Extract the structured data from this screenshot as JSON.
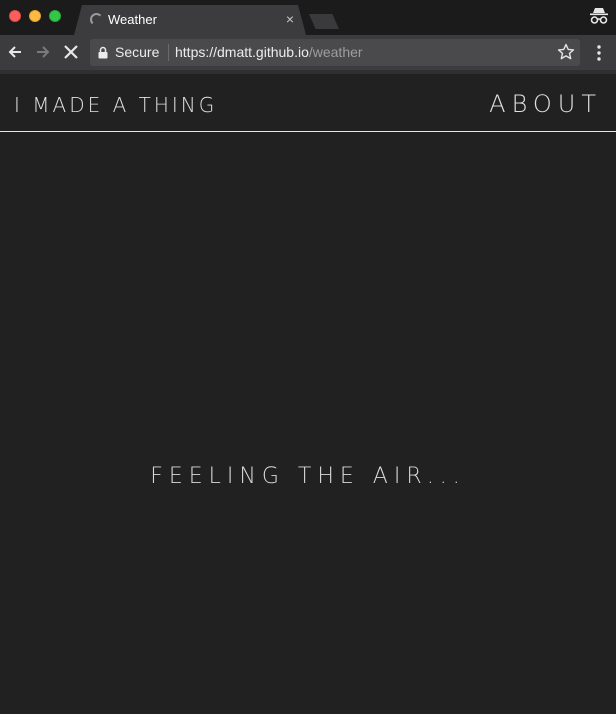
{
  "window": {
    "tab": {
      "title": "Weather",
      "close_glyph": "×",
      "icon": "loading-spinner-icon"
    },
    "colors": {
      "close": "#fc605c",
      "minimize": "#fdbc40",
      "zoom": "#34c84a"
    }
  },
  "toolbar": {
    "security_label": "Secure",
    "url_host": "https://dmatt.github.io",
    "url_path": "/weather",
    "icons": [
      "back-arrow-icon",
      "forward-arrow-icon",
      "stop-loading-icon",
      "lock-icon",
      "bookmark-star-icon",
      "menu-dots-icon",
      "incognito-icon"
    ]
  },
  "page": {
    "brand": "I MADE A THING",
    "nav_about": "ABOUT",
    "status": "FEELING THE AIR...",
    "background": "#212121",
    "text_color": "#e6e6e6"
  }
}
